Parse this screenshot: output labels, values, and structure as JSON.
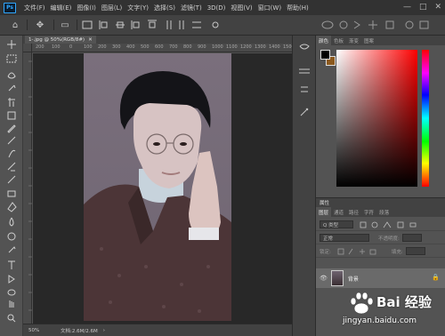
{
  "app": {
    "logo": "Ps"
  },
  "menu": [
    "文件(F)",
    "编辑(E)",
    "图像(I)",
    "图层(L)",
    "文字(Y)",
    "选择(S)",
    "滤镜(T)",
    "3D(D)",
    "视图(V)",
    "窗口(W)",
    "帮助(H)"
  ],
  "window_controls": {
    "minimize": "—",
    "maximize": "□",
    "close": "✕"
  },
  "options_bar": {
    "home": "⌂",
    "move": "✥",
    "auto_select": "▭"
  },
  "document": {
    "tab_title": "1-.jpg @ 50%(RGB/8#)",
    "close": "✕"
  },
  "ruler": {
    "top_ticks": [
      "200",
      "100",
      "0",
      "100",
      "200",
      "300",
      "400",
      "500",
      "600",
      "700",
      "800",
      "900",
      "1000",
      "1100",
      "1200",
      "1300",
      "1400",
      "1500",
      "1600",
      "1700"
    ]
  },
  "status": {
    "zoom": "50%",
    "doc_info": "文档:2.6M/2.6M",
    "arrow": "›"
  },
  "color_panel": {
    "tabs": [
      "颜色",
      "色板",
      "渐变",
      "图案"
    ],
    "fg_color": "#000000",
    "bg_color": "#8c5a1e"
  },
  "properties": {
    "label": "属性"
  },
  "layers_panel": {
    "tabs": [
      "图层",
      "通道",
      "路径",
      "字符",
      "段落"
    ],
    "filter_placeholder": "Q 类型",
    "blend_mode": "正常",
    "opacity_label": "不透明度:",
    "lock_label": "锁定:",
    "fill_label": "填充:",
    "layer_name": "背景",
    "visibility": "👁",
    "lock": "🔒"
  },
  "watermark": {
    "title": "Bai 经验",
    "url": "jingyan.baidu.com"
  }
}
